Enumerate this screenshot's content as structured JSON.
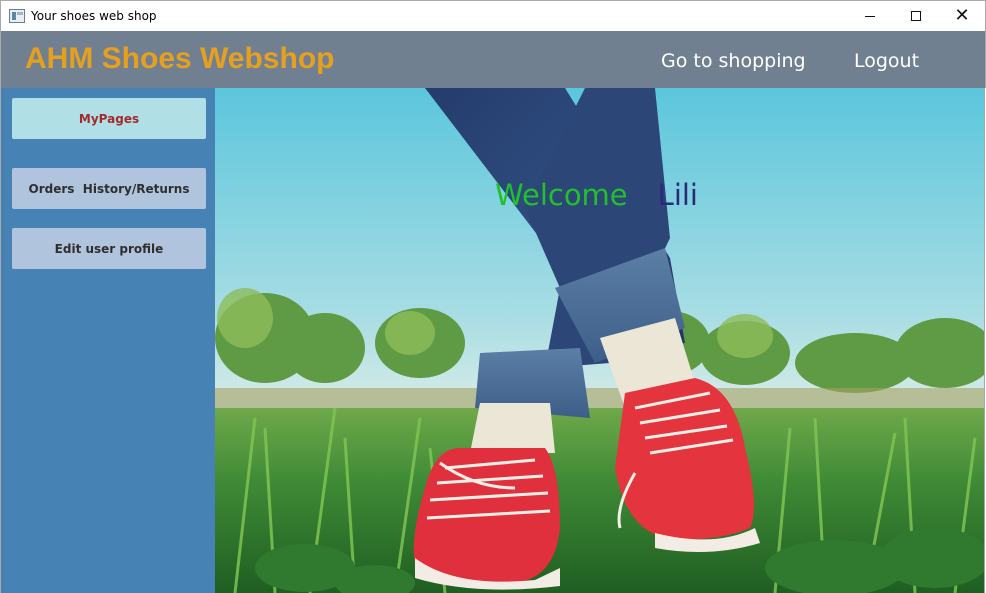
{
  "window": {
    "title": "Your shoes web shop",
    "controls": {
      "minimize": "minimize-icon",
      "maximize": "maximize-icon",
      "close": "close-icon"
    }
  },
  "header": {
    "brand": "AHM Shoes Webshop",
    "nav": {
      "shopping": "Go to shopping",
      "logout": "Logout"
    }
  },
  "sidebar": {
    "items": [
      {
        "label": "MyPages",
        "active": true
      },
      {
        "label": "Orders  History/Returns",
        "active": false
      },
      {
        "label": "Edit user profile",
        "active": false
      }
    ]
  },
  "hero": {
    "welcome": "Welcome",
    "username": "Lili",
    "image": "red-sneakers-on-grass-photo"
  },
  "colors": {
    "header_bg": "#708090",
    "brand": "#e6a020",
    "sidebar_bg": "#4682b4",
    "button_bg": "#b0c4de",
    "button_active_bg": "#b0e0e6",
    "button_active_text": "#a52a2a",
    "welcome": "#22c02a",
    "username": "#2a2a78"
  }
}
